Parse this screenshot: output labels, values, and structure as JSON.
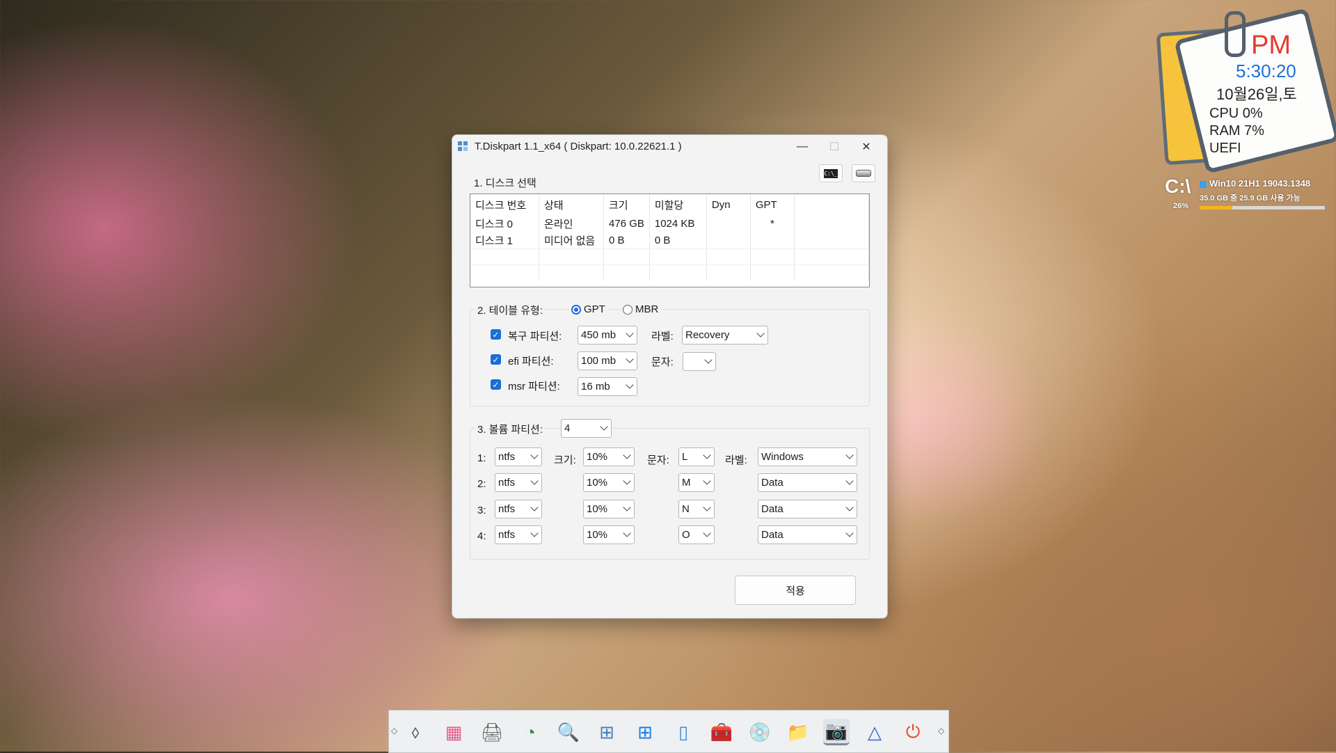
{
  "clock": {
    "ampm": "PM",
    "time": "5:30:20",
    "date": "10월26일,토",
    "cpu": "CPU  0%",
    "ram": "RAM  7%",
    "boot": "UEFI"
  },
  "drive": {
    "letter": "C:\\",
    "os": "Win10 21H1 19043.1348",
    "usage": "35.0 GB 중  25.9 GB 사용 가능",
    "percent_text": "26%",
    "used_fraction": 0.26
  },
  "window": {
    "title": "T.Diskpart 1.1_x64 ( Diskpart: 10.0.22621.1 )",
    "controls": {
      "minimize": "—",
      "maximize": "☐",
      "close": "✕"
    },
    "toolbar": {
      "cmd_icon": "C:\\_"
    },
    "section1": {
      "title": "1. 디스크 선택",
      "headers": [
        "디스크 번호",
        "상태",
        "크기",
        "미할당",
        "Dyn",
        "GPT"
      ],
      "rows": [
        [
          "디스크 0",
          "온라인",
          "476 GB",
          "1024 KB",
          "",
          "*"
        ],
        [
          "디스크 1",
          "미디어 없음",
          "0 B",
          "0 B",
          "",
          ""
        ]
      ]
    },
    "section2": {
      "title": "2. 테이블 유형:",
      "options": [
        "GPT",
        "MBR"
      ],
      "selected": "GPT",
      "recovery_label": "복구 파티션:",
      "recovery_size": "450 mb",
      "label_caption": "라벨:",
      "label_value": "Recovery",
      "efi_label": "efi 파티션:",
      "efi_size": "100 mb",
      "letter_caption": "문자:",
      "letter_value": "",
      "msr_label": "msr 파티션:",
      "msr_size": "16 mb"
    },
    "section3": {
      "title": "3. 볼륨 파티션:",
      "count": "4",
      "size_caption": "크기:",
      "letter_caption": "문자:",
      "label_caption": "라벨:",
      "rows": [
        {
          "num": "1:",
          "fs": "ntfs",
          "size": "10%",
          "letter": "L",
          "label": "Windows"
        },
        {
          "num": "2:",
          "fs": "ntfs",
          "size": "10%",
          "letter": "M",
          "label": "Data"
        },
        {
          "num": "3:",
          "fs": "ntfs",
          "size": "10%",
          "letter": "N",
          "label": "Data"
        },
        {
          "num": "4:",
          "fs": "ntfs",
          "size": "10%",
          "letter": "O",
          "label": "Data"
        }
      ]
    },
    "apply": "적용"
  },
  "taskbar": {
    "icons": [
      "eraser-icon",
      "start-icon",
      "scanner-icon",
      "partition-icon",
      "search-tool-icon",
      "widgets-icon",
      "windows-icon",
      "notepad-icon",
      "toolbox-icon",
      "disk-tool-icon",
      "explorer-icon",
      "camera-icon",
      "drive-icon",
      "power-icon"
    ],
    "glyphs": [
      "⬨",
      "▦",
      "🖨",
      "◔",
      "🔍",
      "⊞",
      "⊞",
      "▯",
      "🧰",
      "💿",
      "📁",
      "📷",
      "△",
      "⏻"
    ]
  }
}
